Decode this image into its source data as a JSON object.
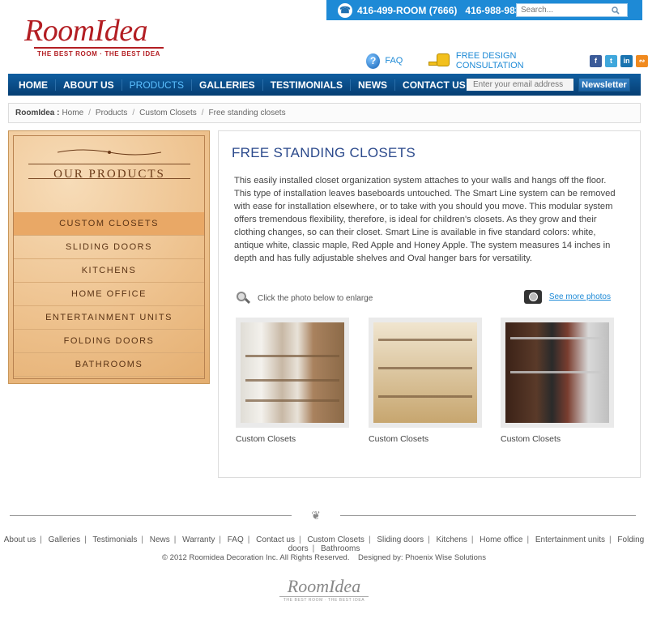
{
  "topbar": {
    "phone1": "416-499-ROOM (7666)",
    "phone2": "416-988-9839",
    "search_placeholder": "Search..."
  },
  "logo": {
    "name": "RoomIdea",
    "tagline": "THE BEST ROOM · THE BEST IDEA"
  },
  "header_links": {
    "faq": "FAQ",
    "consultation": "FREE DESIGN CONSULTATION",
    "social": [
      "f",
      "t",
      "in",
      "rss"
    ]
  },
  "nav": {
    "items": [
      "HOME",
      "ABOUT US",
      "PRODUCTS",
      "GALLERIES",
      "TESTIMONIALS",
      "NEWS",
      "CONTACT US"
    ],
    "active": "PRODUCTS",
    "email_placeholder": "Enter your email address",
    "newsletter_label": "Newsletter"
  },
  "breadcrumb": {
    "site": "RoomIdea :",
    "items": [
      "Home",
      "Products",
      "Custom Closets",
      "Free standing closets"
    ],
    "separator": "/"
  },
  "sidebar": {
    "title": "OUR PRODUCTS",
    "items": [
      "CUSTOM CLOSETS",
      "SLIDING DOORS",
      "KITCHENS",
      "HOME OFFICE",
      "ENTERTAINMENT UNITS",
      "FOLDING DOORS",
      "BATHROOMS"
    ],
    "selected": "CUSTOM CLOSETS"
  },
  "main": {
    "title": "FREE STANDING CLOSETS",
    "description": "This easily installed closet organization system attaches to your walls and hangs off the floor. This type of installation leaves baseboards untouched. The Smart Line system can be removed with ease for installation elsewhere, or to take with you should you move. This modular system offers tremendous flexibility, therefore, is ideal for children's closets. As they grow and their clothing changes, so can their closet. Smart Line is available in five standard colors: white, antique white, classic maple, Red Apple and Honey Apple. The system measures 14 inches in depth and has fully adjustable shelves and Oval hanger bars for versatility.",
    "enlarge_hint": "Click the photo below to enlarge",
    "see_more": "See more photos",
    "photos": [
      {
        "caption": "Custom Closets"
      },
      {
        "caption": "Custom Closets"
      },
      {
        "caption": "Custom Closets"
      }
    ]
  },
  "footer": {
    "links": [
      "About us",
      "Galleries",
      "Testimonials",
      "News",
      "Warranty",
      "FAQ",
      "Contact us",
      "Custom Closets",
      "Sliding doors",
      "Kitchens",
      "Home office",
      "Entertainment units",
      "Folding doors",
      "Bathrooms"
    ],
    "copyright": "© 2012 Roomidea Decoration Inc. All Rights Reserved.",
    "designed_by": "Designed by: Phoenix Wise Solutions",
    "logo_name": "RoomIdea",
    "logo_tagline": "THE BEST ROOM · THE BEST IDEA"
  },
  "colors": {
    "brand_red": "#b31e23",
    "topbar_blue": "#1e8ad6",
    "nav_blue": "#0f5ea0",
    "title_blue": "#2c4a8c"
  }
}
